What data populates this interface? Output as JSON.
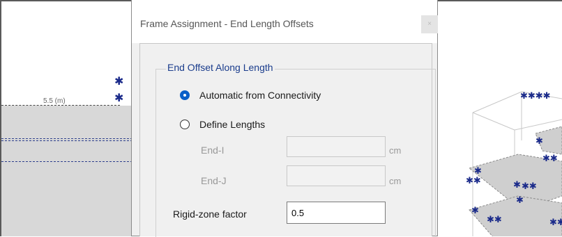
{
  "dialog": {
    "title": "Frame Assignment - End Length Offsets",
    "close_glyph": "×"
  },
  "group": {
    "label": "End Offset Along Length",
    "options": [
      {
        "label": "Automatic from Connectivity",
        "selected": true
      },
      {
        "label": "Define Lengths",
        "selected": false
      }
    ],
    "end_i": {
      "label": "End-I",
      "value": "",
      "unit": "cm"
    },
    "end_j": {
      "label": "End-J",
      "value": "",
      "unit": "cm"
    },
    "rigid_zone": {
      "label": "Rigid-zone factor",
      "value": "0.5"
    }
  },
  "left_view": {
    "dimension_label": "5.5 (m)",
    "node_glyph": "✱"
  },
  "colors": {
    "accent": "#0a5fc8",
    "group_label": "#1a3c8c",
    "node": "#1a2a8a"
  }
}
